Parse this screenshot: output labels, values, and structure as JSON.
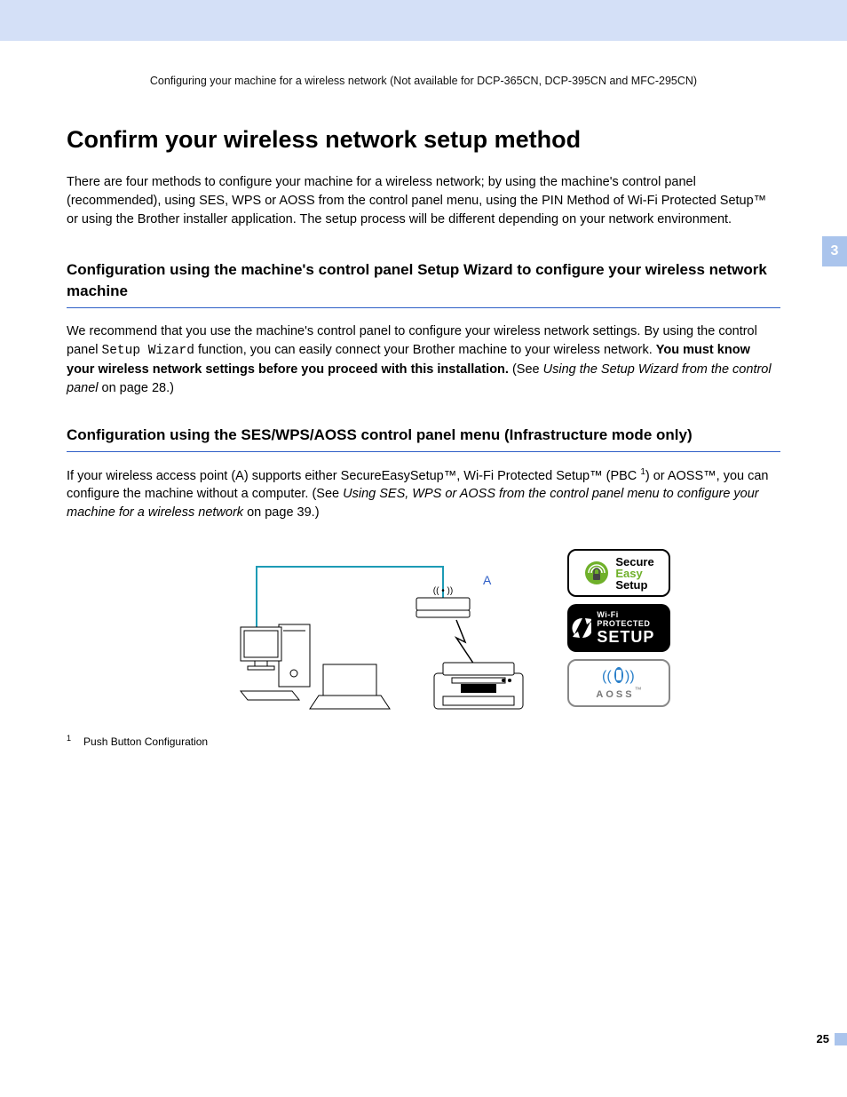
{
  "page": {
    "breadcrumb": "Configuring your machine for a wireless network (Not available for DCP-365CN, DCP-395CN and MFC-295CN)",
    "chapter_tab": "3",
    "page_number": "25"
  },
  "h1": "Confirm your wireless network setup method",
  "intro": "There are four methods to configure your machine for a wireless network; by using the machine's control panel (recommended), using SES, WPS or AOSS from the control panel menu, using the PIN Method of Wi-Fi Protected Setup™ or using the Brother installer application. The setup process will be different depending on your network environment.",
  "section1": {
    "heading": "Configuration using the machine's control panel Setup Wizard to configure your wireless network machine",
    "text_pre": "We recommend that you use the machine's control panel to configure your wireless network settings. By using the control panel ",
    "mono": "Setup Wizard",
    "text_mid": " function, you can easily connect your Brother machine to your wireless network. ",
    "bold": "You must know your wireless network settings before you proceed with this installation.",
    "see_open": " (See ",
    "see_ital": "Using the Setup Wizard from the control panel",
    "see_close": " on page 28.)"
  },
  "section2": {
    "heading": "Configuration using the SES/WPS/AOSS control panel menu (Infrastructure mode only)",
    "text_pre": "If your wireless access point (A) supports either SecureEasySetup™, Wi-Fi Protected Setup™ (PBC ",
    "sup": "1",
    "text_mid": ") or AOSS™, you can configure the machine without a computer. (See ",
    "ital": "Using SES, WPS or AOSS from the control panel menu to configure your machine for a wireless network",
    "text_end": " on page 39.)"
  },
  "diagram": {
    "label_a": "A",
    "wifi_symbol": "(( • ))"
  },
  "logos": {
    "ses_line1": "Secure",
    "ses_line2": "Easy",
    "ses_line3": "Setup",
    "wps_top": "Wi-Fi PROTECTED",
    "wps_main": "SETUP",
    "aoss": "AOSS",
    "aoss_tm": "™"
  },
  "footnote": {
    "marker": "1",
    "text": "Push Button Configuration"
  }
}
